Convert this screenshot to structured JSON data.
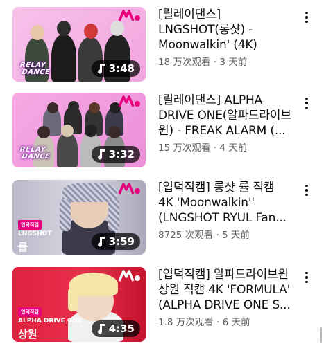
{
  "videos": [
    {
      "title_lines": [
        "[릴레이댄스]",
        "LNGSHOT(롱샷) -",
        "Moonwalkin' (4K)"
      ],
      "meta": "18 万次观看 · 3 天前",
      "duration": "3:48",
      "overlay": "RELAY DANCE",
      "bg_color": "#f3b6e6"
    },
    {
      "title_lines": [
        "[릴레이댄스] ALPHA",
        "DRIVE ONE(알파드라이브",
        "원) - FREAK ALARM (..."
      ],
      "meta": "15 万次观看 · 4 天前",
      "duration": "3:32",
      "overlay": "RELAY DANCE",
      "bg_color": "#f39de0"
    },
    {
      "title_lines": [
        "[입덕직캠] 롱샷 률 직캠",
        "4K 'Moonwalkin''",
        "(LNGSHOT RYUL Fan..."
      ],
      "meta": "8725 次观看 · 5 天前",
      "duration": "3:59",
      "badge": "입덕직캠",
      "group": "LNGSHOT",
      "member": "률",
      "bg_color": "#c9c9d6"
    },
    {
      "title_lines": [
        "[입덕직캠] 알파드라이브원",
        "상원 직캠 4K 'FORMULA'",
        "(ALPHA DRIVE ONE S..."
      ],
      "meta": "1.8 万次观看 · 6 天前",
      "duration": "4:35",
      "badge": "입덕직캠",
      "group": "ALPHA DRIVE ONE",
      "member": "상원",
      "bg_color": "#e41b3a"
    }
  ],
  "colors": {
    "brand": "#e6007e",
    "meta_text": "#606060"
  },
  "icons": {
    "duration": "music-note-icon",
    "more": "more-vert-icon"
  }
}
